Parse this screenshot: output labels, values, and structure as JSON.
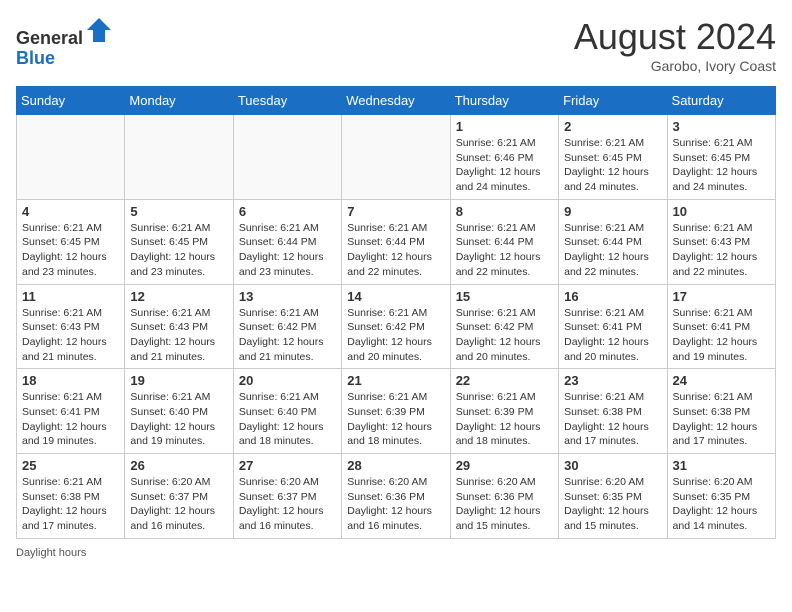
{
  "header": {
    "logo_general": "General",
    "logo_blue": "Blue",
    "month_year": "August 2024",
    "location": "Garobo, Ivory Coast"
  },
  "days_of_week": [
    "Sunday",
    "Monday",
    "Tuesday",
    "Wednesday",
    "Thursday",
    "Friday",
    "Saturday"
  ],
  "weeks": [
    [
      {
        "day": "",
        "info": ""
      },
      {
        "day": "",
        "info": ""
      },
      {
        "day": "",
        "info": ""
      },
      {
        "day": "",
        "info": ""
      },
      {
        "day": "1",
        "info": "Sunrise: 6:21 AM\nSunset: 6:46 PM\nDaylight: 12 hours and 24 minutes."
      },
      {
        "day": "2",
        "info": "Sunrise: 6:21 AM\nSunset: 6:45 PM\nDaylight: 12 hours and 24 minutes."
      },
      {
        "day": "3",
        "info": "Sunrise: 6:21 AM\nSunset: 6:45 PM\nDaylight: 12 hours and 24 minutes."
      }
    ],
    [
      {
        "day": "4",
        "info": "Sunrise: 6:21 AM\nSunset: 6:45 PM\nDaylight: 12 hours and 23 minutes."
      },
      {
        "day": "5",
        "info": "Sunrise: 6:21 AM\nSunset: 6:45 PM\nDaylight: 12 hours and 23 minutes."
      },
      {
        "day": "6",
        "info": "Sunrise: 6:21 AM\nSunset: 6:44 PM\nDaylight: 12 hours and 23 minutes."
      },
      {
        "day": "7",
        "info": "Sunrise: 6:21 AM\nSunset: 6:44 PM\nDaylight: 12 hours and 22 minutes."
      },
      {
        "day": "8",
        "info": "Sunrise: 6:21 AM\nSunset: 6:44 PM\nDaylight: 12 hours and 22 minutes."
      },
      {
        "day": "9",
        "info": "Sunrise: 6:21 AM\nSunset: 6:44 PM\nDaylight: 12 hours and 22 minutes."
      },
      {
        "day": "10",
        "info": "Sunrise: 6:21 AM\nSunset: 6:43 PM\nDaylight: 12 hours and 22 minutes."
      }
    ],
    [
      {
        "day": "11",
        "info": "Sunrise: 6:21 AM\nSunset: 6:43 PM\nDaylight: 12 hours and 21 minutes."
      },
      {
        "day": "12",
        "info": "Sunrise: 6:21 AM\nSunset: 6:43 PM\nDaylight: 12 hours and 21 minutes."
      },
      {
        "day": "13",
        "info": "Sunrise: 6:21 AM\nSunset: 6:42 PM\nDaylight: 12 hours and 21 minutes."
      },
      {
        "day": "14",
        "info": "Sunrise: 6:21 AM\nSunset: 6:42 PM\nDaylight: 12 hours and 20 minutes."
      },
      {
        "day": "15",
        "info": "Sunrise: 6:21 AM\nSunset: 6:42 PM\nDaylight: 12 hours and 20 minutes."
      },
      {
        "day": "16",
        "info": "Sunrise: 6:21 AM\nSunset: 6:41 PM\nDaylight: 12 hours and 20 minutes."
      },
      {
        "day": "17",
        "info": "Sunrise: 6:21 AM\nSunset: 6:41 PM\nDaylight: 12 hours and 19 minutes."
      }
    ],
    [
      {
        "day": "18",
        "info": "Sunrise: 6:21 AM\nSunset: 6:41 PM\nDaylight: 12 hours and 19 minutes."
      },
      {
        "day": "19",
        "info": "Sunrise: 6:21 AM\nSunset: 6:40 PM\nDaylight: 12 hours and 19 minutes."
      },
      {
        "day": "20",
        "info": "Sunrise: 6:21 AM\nSunset: 6:40 PM\nDaylight: 12 hours and 18 minutes."
      },
      {
        "day": "21",
        "info": "Sunrise: 6:21 AM\nSunset: 6:39 PM\nDaylight: 12 hours and 18 minutes."
      },
      {
        "day": "22",
        "info": "Sunrise: 6:21 AM\nSunset: 6:39 PM\nDaylight: 12 hours and 18 minutes."
      },
      {
        "day": "23",
        "info": "Sunrise: 6:21 AM\nSunset: 6:38 PM\nDaylight: 12 hours and 17 minutes."
      },
      {
        "day": "24",
        "info": "Sunrise: 6:21 AM\nSunset: 6:38 PM\nDaylight: 12 hours and 17 minutes."
      }
    ],
    [
      {
        "day": "25",
        "info": "Sunrise: 6:21 AM\nSunset: 6:38 PM\nDaylight: 12 hours and 17 minutes."
      },
      {
        "day": "26",
        "info": "Sunrise: 6:20 AM\nSunset: 6:37 PM\nDaylight: 12 hours and 16 minutes."
      },
      {
        "day": "27",
        "info": "Sunrise: 6:20 AM\nSunset: 6:37 PM\nDaylight: 12 hours and 16 minutes."
      },
      {
        "day": "28",
        "info": "Sunrise: 6:20 AM\nSunset: 6:36 PM\nDaylight: 12 hours and 16 minutes."
      },
      {
        "day": "29",
        "info": "Sunrise: 6:20 AM\nSunset: 6:36 PM\nDaylight: 12 hours and 15 minutes."
      },
      {
        "day": "30",
        "info": "Sunrise: 6:20 AM\nSunset: 6:35 PM\nDaylight: 12 hours and 15 minutes."
      },
      {
        "day": "31",
        "info": "Sunrise: 6:20 AM\nSunset: 6:35 PM\nDaylight: 12 hours and 14 minutes."
      }
    ]
  ],
  "footnote": "Daylight hours"
}
